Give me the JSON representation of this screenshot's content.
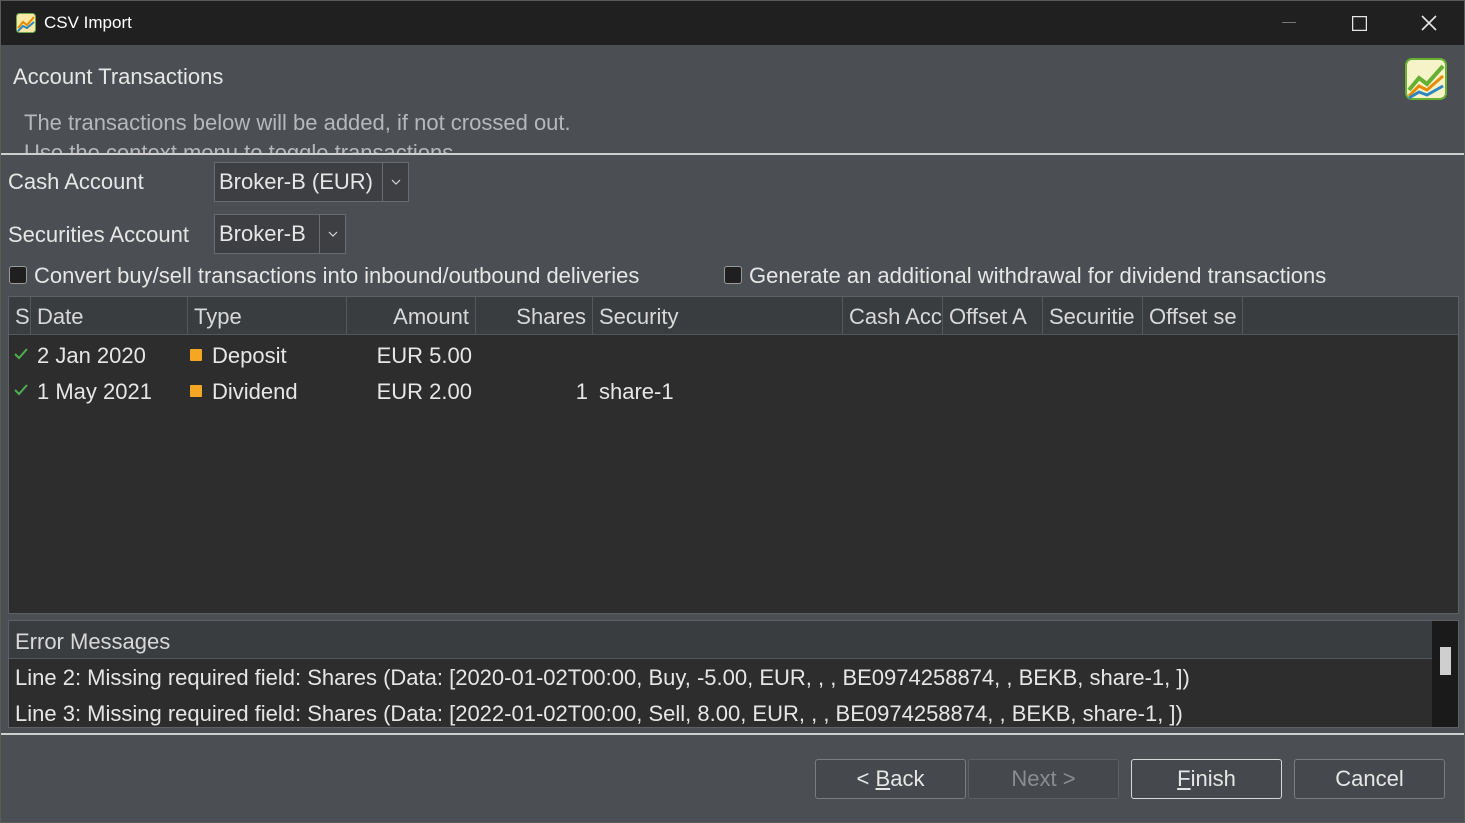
{
  "window": {
    "title": "CSV Import",
    "controls": {
      "minimize": "minimize-icon",
      "maximize": "maximize-icon",
      "close": "close-icon"
    }
  },
  "header": {
    "title": "Account Transactions",
    "description_line1": "The transactions below will be added, if not crossed out.",
    "description_line2": "Use the context menu to toggle transactions."
  },
  "form": {
    "cash_account_label": "Cash Account",
    "cash_account_value": "Broker-B (EUR)",
    "securities_account_label": "Securities Account",
    "securities_account_value": "Broker-B",
    "convert_checkbox_label": "Convert buy/sell transactions into inbound/outbound deliveries",
    "convert_checked": false,
    "withdrawal_checkbox_label": "Generate an additional withdrawal for dividend transactions",
    "withdrawal_checked": false
  },
  "table": {
    "columns": [
      "S",
      "Date",
      "Type",
      "Amount",
      "Shares",
      "Security",
      "Cash Acc",
      "Offset A",
      "Securitie",
      "Offset se"
    ],
    "rows": [
      {
        "status": "check-icon",
        "date": "2 Jan 2020",
        "type": "Deposit",
        "amount": "EUR 5.00",
        "shares": "",
        "security": ""
      },
      {
        "status": "check-icon",
        "date": "1 May 2021",
        "type": "Dividend",
        "amount": "EUR 2.00",
        "shares": "1",
        "security": "share-1"
      }
    ]
  },
  "errors": {
    "title": "Error Messages",
    "lines": [
      "Line 2: Missing required field: Shares (Data: [2020-01-02T00:00, Buy, -5.00, EUR, , , BE0974258874, , BEKB, share-1, ])",
      "Line 3: Missing required field: Shares (Data: [2022-01-02T00:00, Sell, 8.00, EUR, , , BE0974258874, , BEKB, share-1, ])"
    ]
  },
  "buttons": {
    "back_prefix": "< ",
    "back_mnemonic": "B",
    "back_rest": "ack",
    "next": "Next >",
    "finish_mnemonic": "F",
    "finish_rest": "inish",
    "cancel": "Cancel"
  },
  "colors": {
    "check": "#4caf50",
    "type_marker": "#f5a623"
  }
}
